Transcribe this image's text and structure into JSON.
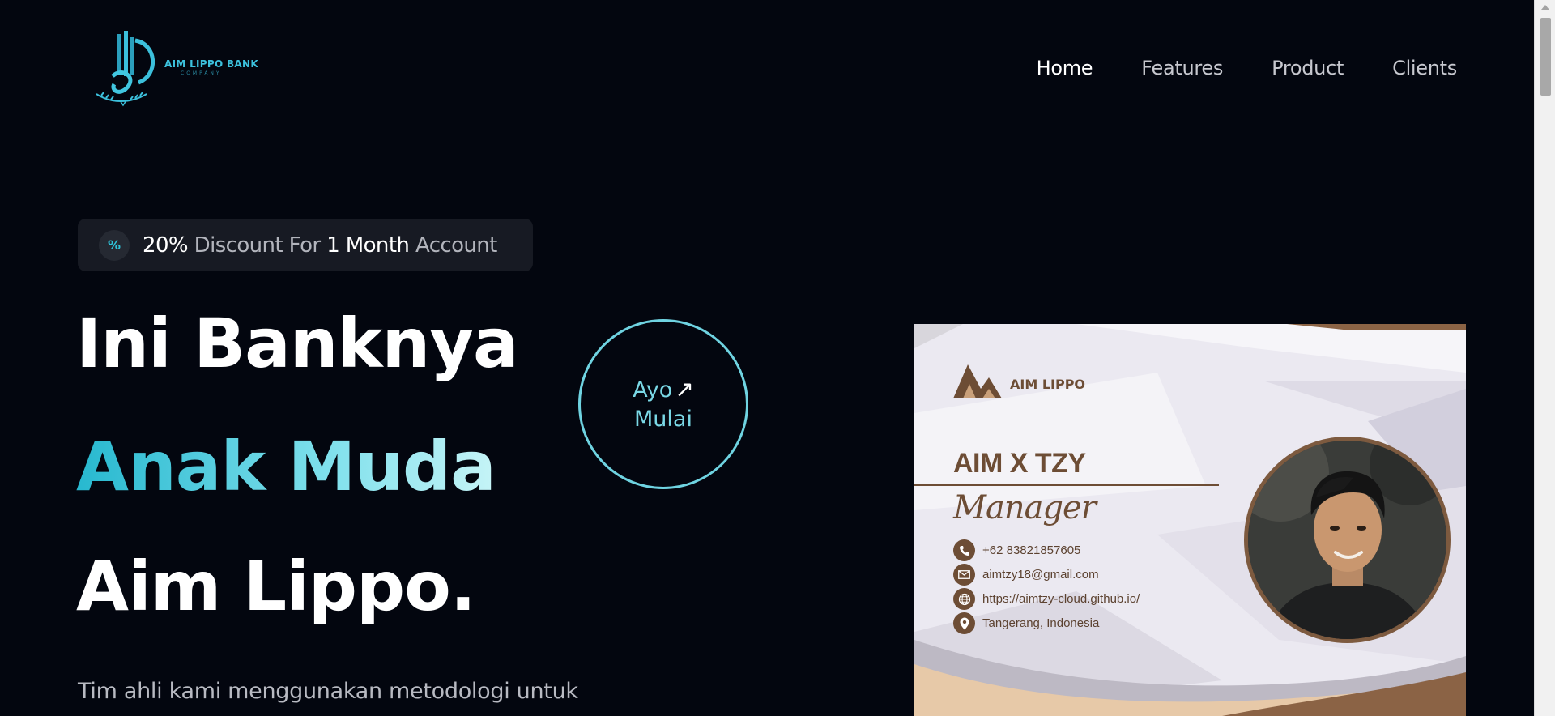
{
  "brand": {
    "name": "AIM LIPPO BANK",
    "subtitle": "COMPANY",
    "accent": "#3cc0dc",
    "logo_icon": "bank-logo-icon"
  },
  "nav": {
    "items": [
      {
        "label": "Home",
        "active": true
      },
      {
        "label": "Features",
        "active": false
      },
      {
        "label": "Product",
        "active": false
      },
      {
        "label": "Clients",
        "active": false
      }
    ]
  },
  "promo": {
    "icon": "percent-icon",
    "glyph": "%",
    "value": "20%",
    "text_1": "Discount For",
    "duration": "1 Month",
    "text_2": "Account"
  },
  "hero": {
    "line1": "Ini Banknya",
    "line2": "Anak Muda",
    "line3": "Aim Lippo.",
    "subtext": "Tim ahli kami menggunakan metodologi untuk",
    "gradient": [
      "#27b8cf",
      "#c6f4f7"
    ]
  },
  "cta": {
    "line1": "Ayo",
    "line2": "Mulai",
    "arrow": "↗",
    "icon": "arrow-up-right-icon",
    "color": "#6fd3e1"
  },
  "card": {
    "brand": "AIM LIPPO",
    "name": "AIM X TZY",
    "title": "Manager",
    "accent": "#6d4d35",
    "contacts": [
      {
        "icon": "phone-icon",
        "text": "+62 83821857605"
      },
      {
        "icon": "mail-icon",
        "text": "aimtzy18@gmail.com"
      },
      {
        "icon": "globe-icon",
        "text": "https://aimtzy-cloud.github.io/"
      },
      {
        "icon": "location-pin-icon",
        "text": "Tangerang, Indonesia"
      }
    ]
  }
}
